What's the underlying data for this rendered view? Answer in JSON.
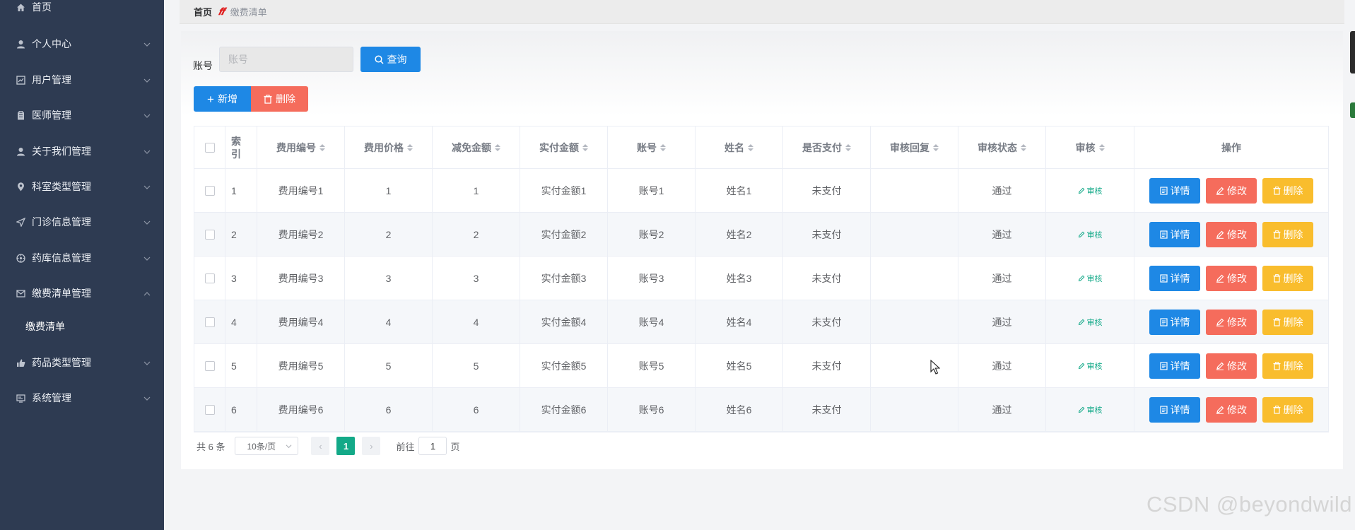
{
  "sidebar": {
    "items": [
      {
        "label": "首页",
        "icon": "home-icon",
        "expandable": false
      },
      {
        "label": "个人中心",
        "icon": "user-icon",
        "expandable": true
      },
      {
        "label": "用户管理",
        "icon": "chart-icon",
        "expandable": true
      },
      {
        "label": "医师管理",
        "icon": "briefcase-icon",
        "expandable": true
      },
      {
        "label": "关于我们管理",
        "icon": "user-icon",
        "expandable": true
      },
      {
        "label": "科室类型管理",
        "icon": "location-icon",
        "expandable": true
      },
      {
        "label": "门诊信息管理",
        "icon": "send-icon",
        "expandable": true
      },
      {
        "label": "药库信息管理",
        "icon": "dashboard-icon",
        "expandable": true
      },
      {
        "label": "缴费清单管理",
        "icon": "message-icon",
        "expandable": true,
        "expanded": true
      },
      {
        "label": "药品类型管理",
        "icon": "thumb-icon",
        "expandable": true
      },
      {
        "label": "系统管理",
        "icon": "monitor-icon",
        "expandable": true
      }
    ],
    "submenu": {
      "label": "缴费清单"
    }
  },
  "breadcrumb": {
    "home": "首页",
    "separator": "𝒇𝒇",
    "current": "缴费清单"
  },
  "search": {
    "label": "账号",
    "placeholder": "账号",
    "value": "",
    "button_label": "查询"
  },
  "toolbar": {
    "add_label": "新增",
    "delete_label": "删除"
  },
  "table": {
    "headers": {
      "index": "索引",
      "fee_no": "费用编号",
      "fee_price": "费用价格",
      "discount": "减免金额",
      "actual": "实付金额",
      "account": "账号",
      "name": "姓名",
      "paid": "是否支付",
      "audit_reply": "审核回复",
      "audit_status": "审核状态",
      "audit": "审核",
      "ops": "操作"
    },
    "rows": [
      {
        "index": "1",
        "fee_no": "费用编号1",
        "fee_price": "1",
        "discount": "1",
        "actual": "实付金额1",
        "account": "账号1",
        "name": "姓名1",
        "paid": "未支付",
        "audit_reply": "",
        "audit_status": "通过"
      },
      {
        "index": "2",
        "fee_no": "费用编号2",
        "fee_price": "2",
        "discount": "2",
        "actual": "实付金额2",
        "account": "账号2",
        "name": "姓名2",
        "paid": "未支付",
        "audit_reply": "",
        "audit_status": "通过"
      },
      {
        "index": "3",
        "fee_no": "费用编号3",
        "fee_price": "3",
        "discount": "3",
        "actual": "实付金额3",
        "account": "账号3",
        "name": "姓名3",
        "paid": "未支付",
        "audit_reply": "",
        "audit_status": "通过"
      },
      {
        "index": "4",
        "fee_no": "费用编号4",
        "fee_price": "4",
        "discount": "4",
        "actual": "实付金额4",
        "account": "账号4",
        "name": "姓名4",
        "paid": "未支付",
        "audit_reply": "",
        "audit_status": "通过"
      },
      {
        "index": "5",
        "fee_no": "费用编号5",
        "fee_price": "5",
        "discount": "5",
        "actual": "实付金额5",
        "account": "账号5",
        "name": "姓名5",
        "paid": "未支付",
        "audit_reply": "",
        "audit_status": "通过"
      },
      {
        "index": "6",
        "fee_no": "费用编号6",
        "fee_price": "6",
        "discount": "6",
        "actual": "实付金额6",
        "account": "账号6",
        "name": "姓名6",
        "paid": "未支付",
        "audit_reply": "",
        "audit_status": "通过"
      }
    ],
    "row_actions": {
      "audit": "审核",
      "detail": "详情",
      "edit": "修改",
      "delete": "删除"
    }
  },
  "pagination": {
    "total": "共 6 条",
    "page_size": "10条/页",
    "current_page": "1",
    "goto_label": "前往",
    "goto_value": "1",
    "page_suffix": "页"
  },
  "watermark": "CSDN @beyondwild",
  "colors": {
    "sidebar_bg": "#2e3b52",
    "primary": "#1e88e5",
    "danger": "#f56c5c",
    "warning": "#f9bd2d",
    "success": "#13a988"
  }
}
